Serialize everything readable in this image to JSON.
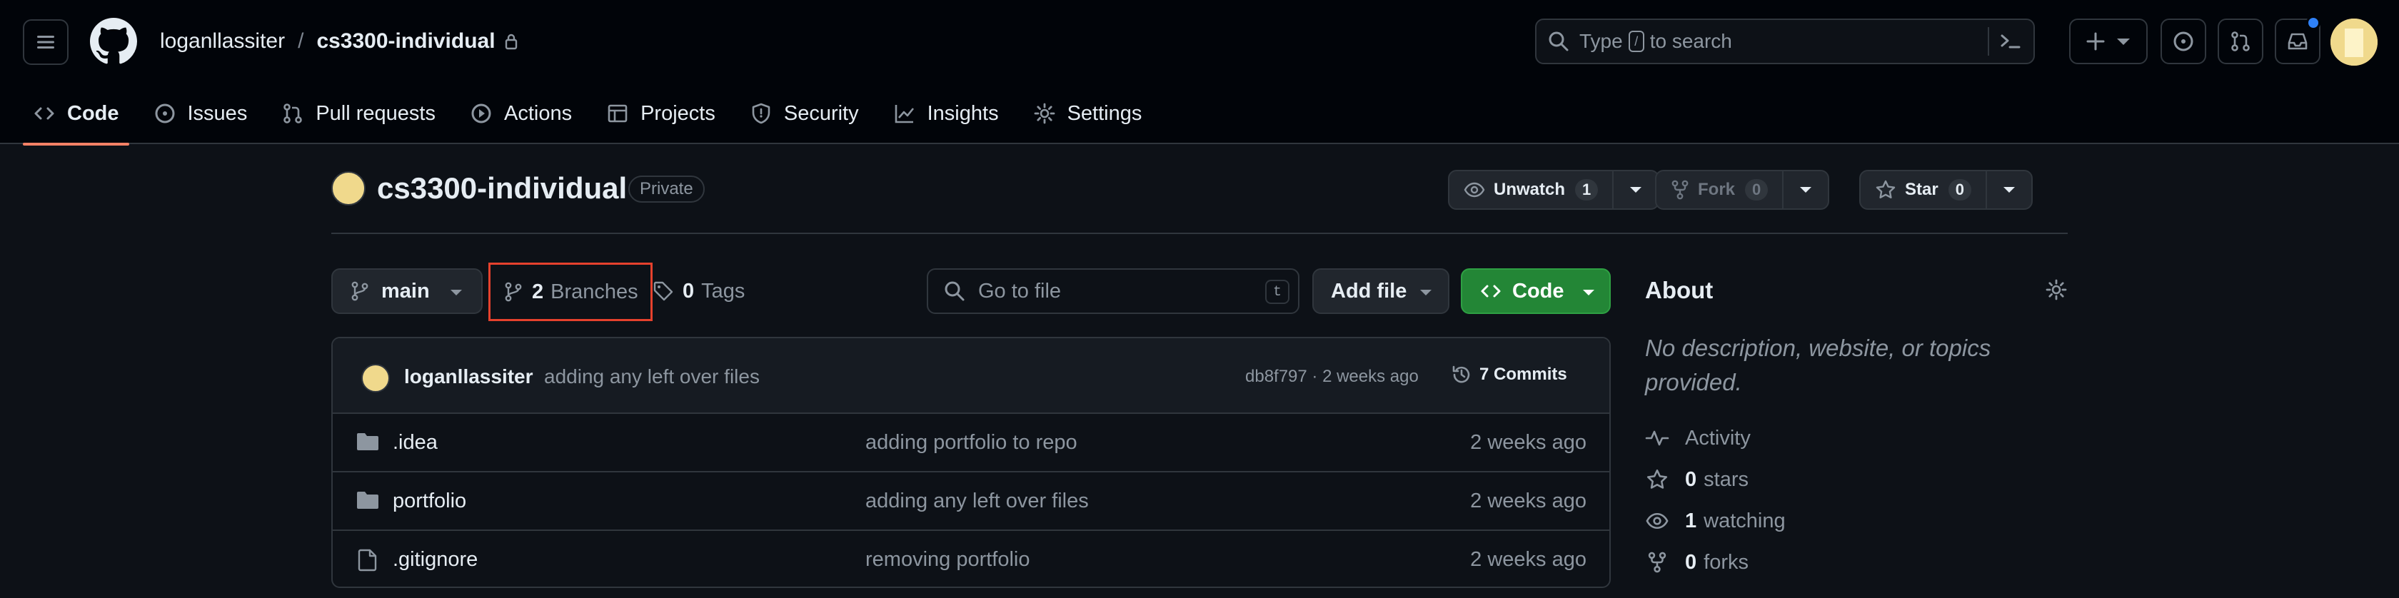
{
  "header": {
    "owner": "loganllassiter",
    "separator": "/",
    "repo": "cs3300-individual",
    "search": {
      "prefix": "Type",
      "key": "/",
      "suffix": "to search"
    }
  },
  "nav": [
    {
      "label": "Code",
      "icon": "code-icon",
      "active": true
    },
    {
      "label": "Issues",
      "icon": "issue-icon",
      "active": false
    },
    {
      "label": "Pull requests",
      "icon": "pull-request-icon",
      "active": false
    },
    {
      "label": "Actions",
      "icon": "play-icon",
      "active": false
    },
    {
      "label": "Projects",
      "icon": "table-icon",
      "active": false
    },
    {
      "label": "Security",
      "icon": "shield-icon",
      "active": false
    },
    {
      "label": "Insights",
      "icon": "graph-icon",
      "active": false
    },
    {
      "label": "Settings",
      "icon": "gear-icon",
      "active": false
    }
  ],
  "repo": {
    "name": "cs3300-individual",
    "visibility": "Private",
    "watch": {
      "label": "Unwatch",
      "count": "1"
    },
    "fork": {
      "label": "Fork",
      "count": "0"
    },
    "star": {
      "label": "Star",
      "count": "0"
    }
  },
  "toolbar": {
    "branch": "main",
    "branches_count": "2",
    "branches_label": "Branches",
    "tags_count": "0",
    "tags_label": "Tags",
    "goto_placeholder": "Go to file",
    "goto_key": "t",
    "add_file": "Add file",
    "code": "Code"
  },
  "commit": {
    "author": "loganllassiter",
    "message": "adding any left over files",
    "meta": "db8f797 · 2 weeks ago",
    "commits_label": "7 Commits"
  },
  "files": [
    {
      "name": ".idea",
      "type": "folder",
      "message": "adding portfolio to repo",
      "date": "2 weeks ago"
    },
    {
      "name": "portfolio",
      "type": "folder",
      "message": "adding any left over files",
      "date": "2 weeks ago"
    },
    {
      "name": ".gitignore",
      "type": "file",
      "message": "removing portfolio",
      "date": "2 weeks ago"
    }
  ],
  "about": {
    "title": "About",
    "description": "No description, website, or topics provided.",
    "activity": "Activity",
    "stars_count": "0",
    "stars_label": "stars",
    "watching_count": "1",
    "watching_label": "watching",
    "forks_count": "0",
    "forks_label": "forks"
  },
  "colors": {
    "background": "#0d1117",
    "header_bg": "#010409",
    "accent_tab": "#f78166",
    "code_button": "#238636",
    "highlight_box": "#e5412d",
    "notification_dot": "#2f81f7"
  }
}
